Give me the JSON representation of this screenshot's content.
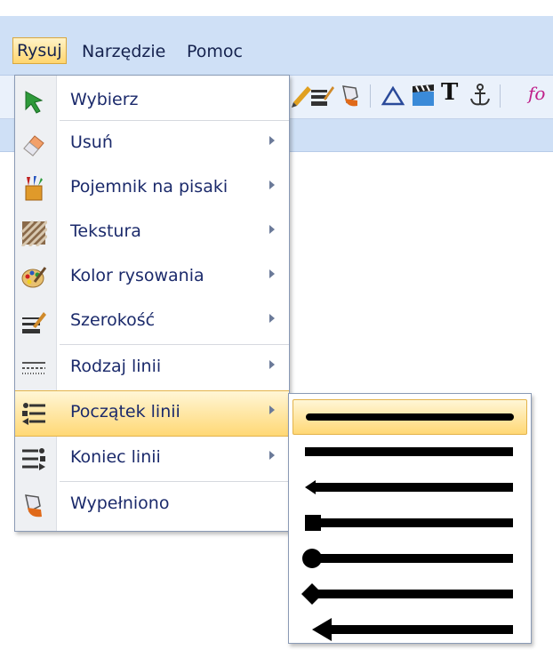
{
  "menubar": {
    "items": [
      {
        "label": "Rysuj",
        "active": true
      },
      {
        "label": "Narzędzie",
        "active": false
      },
      {
        "label": "Pomoc",
        "active": false
      }
    ]
  },
  "toolbar": {
    "text_tool_label": "T",
    "partial_label": "fo"
  },
  "draw_menu": {
    "items": [
      {
        "label": "Wybierz",
        "icon": "cursor-arrow-icon",
        "submenu": false
      },
      {
        "label": "Usuń",
        "icon": "eraser-icon",
        "submenu": true
      },
      {
        "label": "Pojemnik na pisaki",
        "icon": "pen-holder-icon",
        "submenu": true
      },
      {
        "label": "Tekstura",
        "icon": "texture-icon",
        "submenu": true
      },
      {
        "label": "Kolor rysowania",
        "icon": "color-palette-icon",
        "submenu": true
      },
      {
        "label": "Szerokość",
        "icon": "line-width-icon",
        "submenu": true
      },
      {
        "label": "Rodzaj linii",
        "icon": "line-style-icon",
        "submenu": true
      },
      {
        "label": "Początek linii",
        "icon": "line-start-icon",
        "submenu": true,
        "highlighted": true
      },
      {
        "label": "Koniec linii",
        "icon": "line-end-icon",
        "submenu": true
      },
      {
        "label": "Wypełniono",
        "icon": "fill-bucket-icon",
        "submenu": false
      }
    ]
  },
  "line_start_submenu": {
    "options": [
      "none",
      "flat",
      "arrow-open",
      "square",
      "circle",
      "diamond",
      "arrow-filled"
    ],
    "selected": "none"
  },
  "colors": {
    "menubar_bg": "#cfe0f6",
    "highlight": "#ffd875",
    "text": "#1b2a6b"
  }
}
